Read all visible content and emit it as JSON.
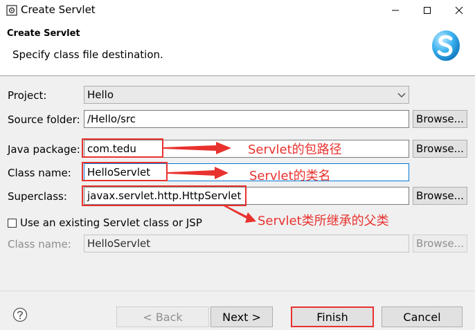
{
  "window": {
    "title": "Create Servlet",
    "minimize_glyph": "—",
    "maximize_glyph": "☐",
    "close_glyph": "✕"
  },
  "banner": {
    "title": "Create Servlet",
    "description": "Specify class file destination."
  },
  "form": {
    "project": {
      "label": "Project:",
      "value": "Hello"
    },
    "source_folder": {
      "label": "Source folder:",
      "value": "/Hello/src",
      "browse": "Browse..."
    },
    "java_package": {
      "label": "Java package:",
      "value": "com.tedu",
      "browse": "Browse..."
    },
    "class_name": {
      "label": "Class name:",
      "value": "HelloServlet"
    },
    "superclass": {
      "label": "Superclass:",
      "value": "javax.servlet.http.HttpServlet",
      "browse": "Browse..."
    },
    "existing_servlet": {
      "label": "Use an existing Servlet class or JSP",
      "checked": false
    },
    "existing_class_name": {
      "label": "Class name:",
      "value": "HelloServlet",
      "browse": "Browse..."
    }
  },
  "annotations": {
    "package_note": "Servlet的包路径",
    "class_note": "Servlet的类名",
    "superclass_note": "Servlet类所继承的父类",
    "color": "#e8322e"
  },
  "footer": {
    "back": "< Back",
    "next": "Next >",
    "finish": "Finish",
    "cancel": "Cancel"
  },
  "icons": {
    "app": "servlet-wizard-icon",
    "logo": "servlet-logo-icon",
    "help": "help-icon"
  }
}
